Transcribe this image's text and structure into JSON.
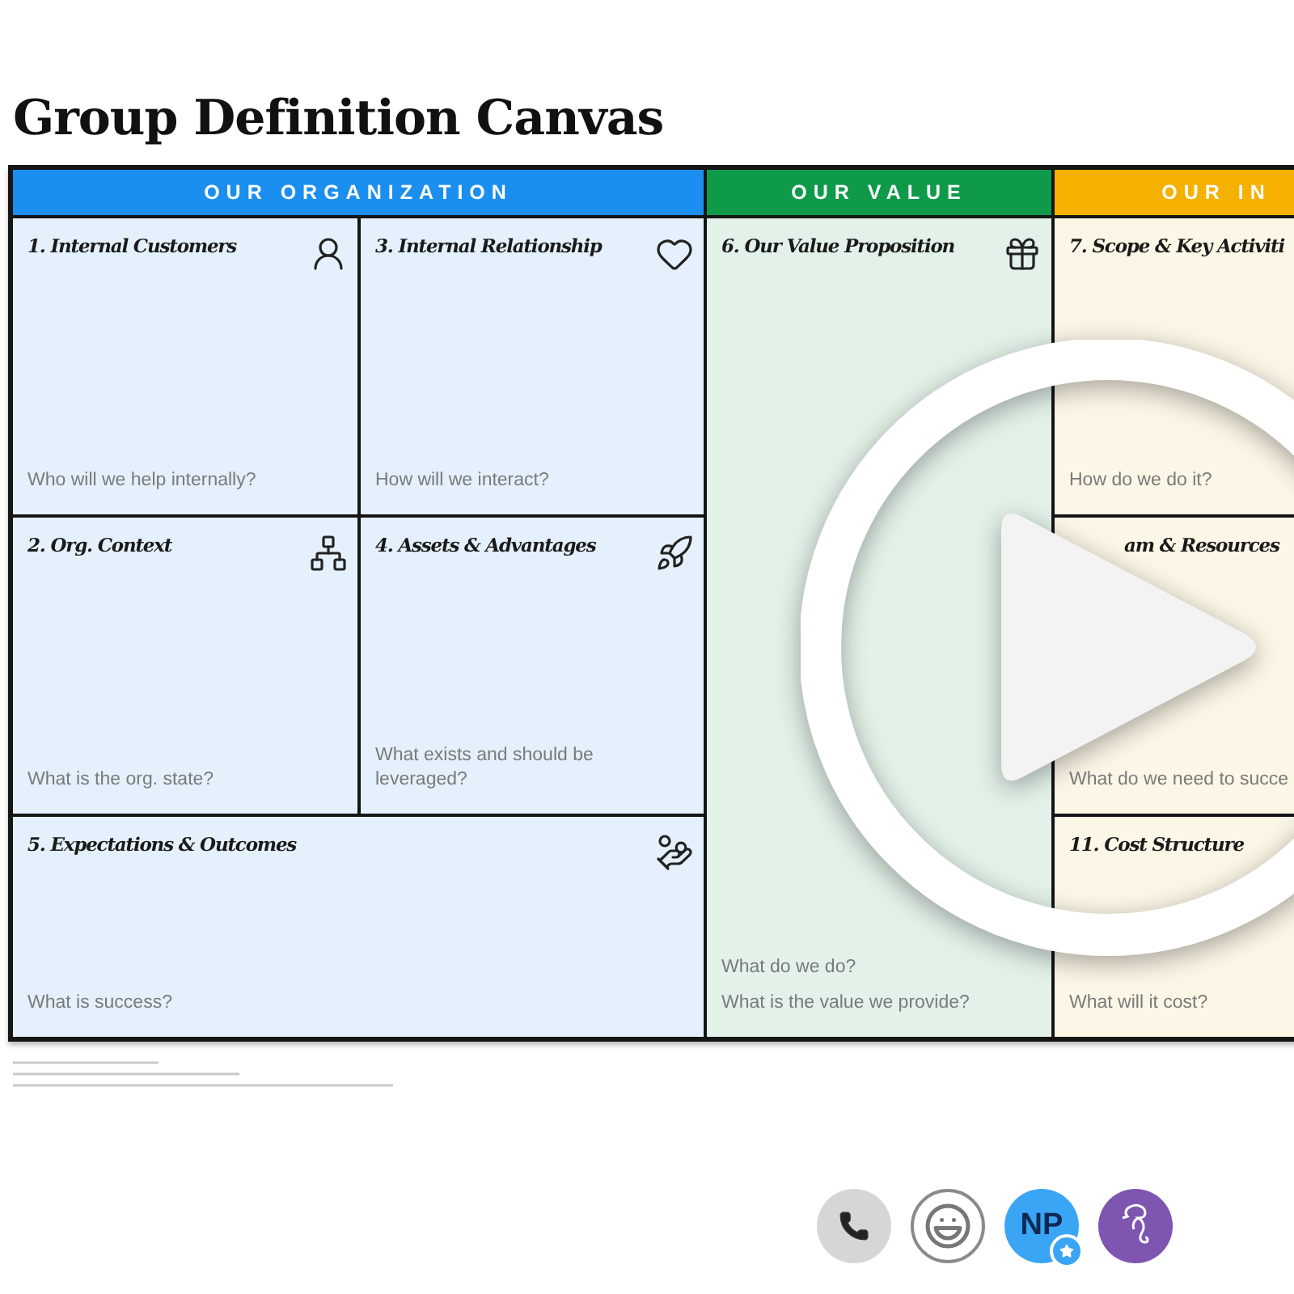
{
  "title": "Group Definition Canvas",
  "sections": [
    {
      "header": "OUR ORGANIZATION",
      "color": "#1a8ff0",
      "blocks": [
        {
          "heading": "1. Internal Customers",
          "prompts": [
            "Who will we help internally?"
          ]
        },
        {
          "heading": "3. Internal Relationship",
          "prompts": [
            "How will we interact?"
          ]
        },
        {
          "heading": "2. Org. Context",
          "prompts": [
            "What is the org. state?"
          ]
        },
        {
          "heading": "4. Assets & Advantages",
          "prompts": [
            "What exists and should be leveraged?"
          ]
        },
        {
          "heading": "5. Expectations & Outcomes",
          "prompts": [
            "What is success?"
          ]
        }
      ]
    },
    {
      "header": "OUR VALUE",
      "color": "#0f9a4a",
      "blocks": [
        {
          "heading": "6. Our Value Proposition",
          "prompts": [
            "What do we do?",
            "What is the value we provide?"
          ]
        }
      ]
    },
    {
      "header": "OUR IN",
      "color": "#f5b000",
      "blocks": [
        {
          "heading": "7. Scope & Key Activiti",
          "prompts": [
            "How do we do it?"
          ]
        },
        {
          "heading": "am & Resources",
          "prompts": [
            "What do we need to succe"
          ]
        },
        {
          "heading": "11. Cost Structure",
          "prompts": [
            "What will it cost?"
          ]
        }
      ]
    }
  ],
  "call_bar": {
    "avatar_initials": "NP"
  }
}
